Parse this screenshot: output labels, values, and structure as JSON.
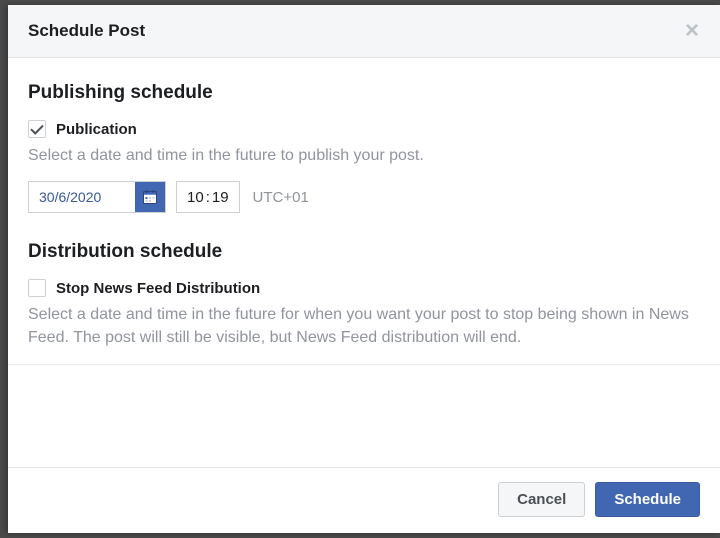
{
  "dialog": {
    "title": "Schedule Post"
  },
  "publishing": {
    "heading": "Publishing schedule",
    "checkbox_label": "Publication",
    "checked": true,
    "help": "Select a date and time in the future to publish your post.",
    "date": "30/6/2020",
    "time_h": "10",
    "time_m": "19",
    "timezone": "UTC+01"
  },
  "distribution": {
    "heading": "Distribution schedule",
    "checkbox_label": "Stop News Feed Distribution",
    "checked": false,
    "help": "Select a date and time in the future for when you want your post to stop being shown in News Feed. The post will still be visible, but News Feed distribution will end."
  },
  "footer": {
    "cancel": "Cancel",
    "schedule": "Schedule"
  }
}
